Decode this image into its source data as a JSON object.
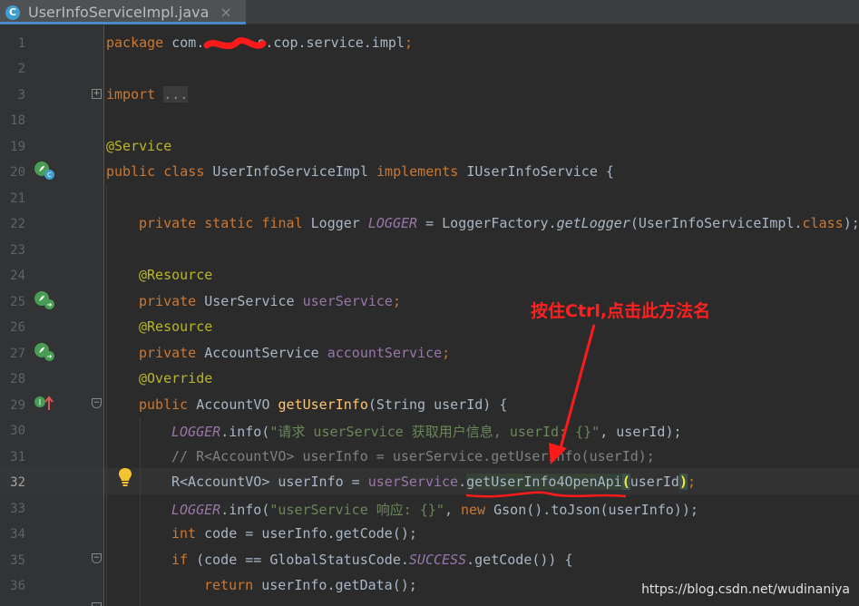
{
  "tab": {
    "icon_letter": "C",
    "filename": "UserInfoServiceImpl.java",
    "close_glyph": "×"
  },
  "lines": {
    "n1": "1",
    "n2": "2",
    "n3": "3",
    "n18": "18",
    "n19": "19",
    "n20": "20",
    "n21": "21",
    "n22": "22",
    "n23": "23",
    "n24": "24",
    "n25": "25",
    "n26": "26",
    "n27": "27",
    "n28": "28",
    "n29": "29",
    "n30": "30",
    "n31": "31",
    "n32": "32",
    "n33": "33",
    "n34": "34",
    "n35": "35",
    "n36": "36"
  },
  "code": {
    "l1_kw": "package",
    "l1_pkg_a": " com.",
    "l1_pkg_b": "s.cop.service.impl",
    "l1_semi": ";",
    "l3_kw": "import",
    "l3_fold": "...",
    "l19_ann": "@Service",
    "l20_kw1": "public class ",
    "l20_name": "UserInfoServiceImpl ",
    "l20_kw2": "implements ",
    "l20_iface": "IUserInfoService {",
    "l22_kw": "private static final ",
    "l22_type": "Logger ",
    "l22_field": "LOGGER",
    "l22_eq": " = LoggerFactory.",
    "l22_method": "getLogger",
    "l22_args": "(UserInfoServiceImpl.",
    "l22_class": "class",
    "l22_end": ");",
    "l24_ann": "@Resource",
    "l25_kw": "private ",
    "l25_type": "UserService ",
    "l25_field": "userService",
    "l25_semi": ";",
    "l26_ann": "@Resource",
    "l27_kw": "private ",
    "l27_type": "AccountService ",
    "l27_field": "accountService",
    "l27_semi": ";",
    "l28_ann": "@Override",
    "l29_kw": "public ",
    "l29_type": "AccountVO ",
    "l29_method": "getUserInfo",
    "l29_params": "(String userId) {",
    "l30_field": "LOGGER",
    "l30_call": ".info(",
    "l30_str": "\"请求 userService 获取用户信息, userId: {}\"",
    "l30_end": ", userId);",
    "l31_cmt": "// R<AccountVO> userInfo = userService.getUserInfo(userId);",
    "l32_a": "R<AccountVO> userInfo = ",
    "l32_field": "userService",
    "l32_dot": ".",
    "l32_method": "getUserInfo4OpenApi",
    "l32_paren": "(",
    "l32_arg": "userId",
    "l32_close": ")",
    "l32_semi": ";",
    "l33_field": "LOGGER",
    "l33_call": ".info(",
    "l33_str": "\"userService 响应: {}\"",
    "l33_comma": ", ",
    "l33_kw": "new ",
    "l33_end": "Gson().toJson(userInfo));",
    "l34_kw": "int ",
    "l34_rest": "code = userInfo.getCode();",
    "l35_kw": "if ",
    "l35_a": "(code == GlobalStatusCode.",
    "l35_field": "SUCCESS",
    "l35_b": ".getCode()) {",
    "l36_kw": "return ",
    "l36_rest": "userInfo.getData();"
  },
  "gutter_icons": {
    "l20": "class-implements-icon",
    "l25": "injected-bean-icon",
    "l27": "injected-bean-icon",
    "l29": "override-implements-icon",
    "l32": "lightbulb-icon"
  },
  "annotation": {
    "text": "按住Ctrl,点击此方法名",
    "color": "#ff2020"
  },
  "watermark": "https://blog.csdn.net/wudinaniya",
  "colors": {
    "background": "#2b2b2b",
    "keyword": "#cc7832",
    "annotation": "#bbb529",
    "string": "#6a8759",
    "field": "#9876aa",
    "method": "#ffc66d",
    "comment": "#808080"
  }
}
